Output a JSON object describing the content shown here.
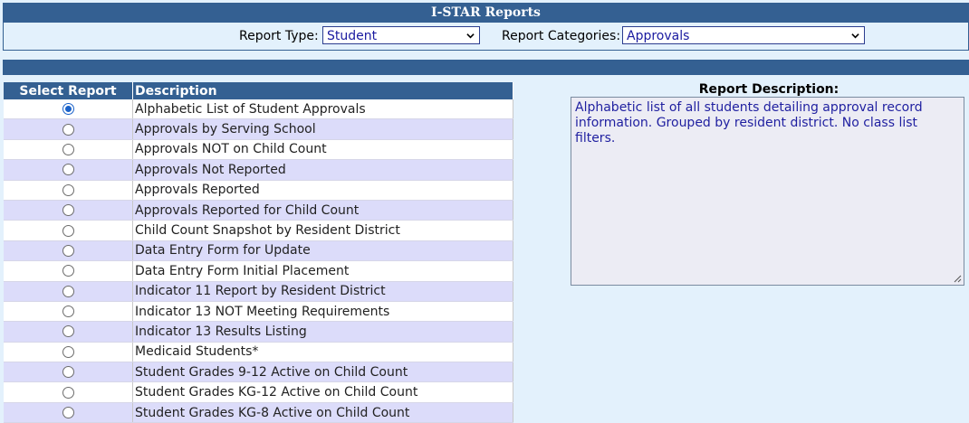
{
  "header": {
    "title": "I-STAR Reports"
  },
  "filters": {
    "report_type_label": "Report Type:",
    "report_type_value": "Student",
    "report_categories_label": "Report Categories:",
    "report_categories_value": "Approvals"
  },
  "table": {
    "col_select": "Select Report",
    "col_description": "Description",
    "rows": [
      {
        "label": "Alphabetic List of Student Approvals",
        "selected": true
      },
      {
        "label": "Approvals by Serving School",
        "selected": false
      },
      {
        "label": "Approvals NOT on Child Count",
        "selected": false
      },
      {
        "label": "Approvals Not Reported",
        "selected": false
      },
      {
        "label": "Approvals Reported",
        "selected": false
      },
      {
        "label": "Approvals Reported for Child Count",
        "selected": false
      },
      {
        "label": "Child Count Snapshot by Resident District",
        "selected": false
      },
      {
        "label": "Data Entry Form for Update",
        "selected": false
      },
      {
        "label": "Data Entry Form Initial Placement",
        "selected": false
      },
      {
        "label": "Indicator 11 Report by Resident District",
        "selected": false
      },
      {
        "label": "Indicator 13 NOT Meeting Requirements",
        "selected": false
      },
      {
        "label": "Indicator 13 Results Listing",
        "selected": false
      },
      {
        "label": "Medicaid Students*",
        "selected": false
      },
      {
        "label": "Student Grades 9-12 Active on Child Count",
        "selected": false
      },
      {
        "label": "Student Grades KG-12 Active on Child Count",
        "selected": false
      },
      {
        "label": "Student Grades KG-8 Active on Child Count",
        "selected": false
      }
    ]
  },
  "description": {
    "heading": "Report Description:",
    "text": "Alphabetic list of all students detailing approval record information.  Grouped by resident district.  No class list filters."
  },
  "colors": {
    "header_bg": "#346092",
    "page_bg": "#e3f1fc",
    "row_alt": "#dcdcfa",
    "select_text": "#1a1aa0"
  },
  "icons": {
    "dropdown": "chevron-down-icon",
    "radio": "radio-icon",
    "resize": "resize-grip-icon"
  }
}
